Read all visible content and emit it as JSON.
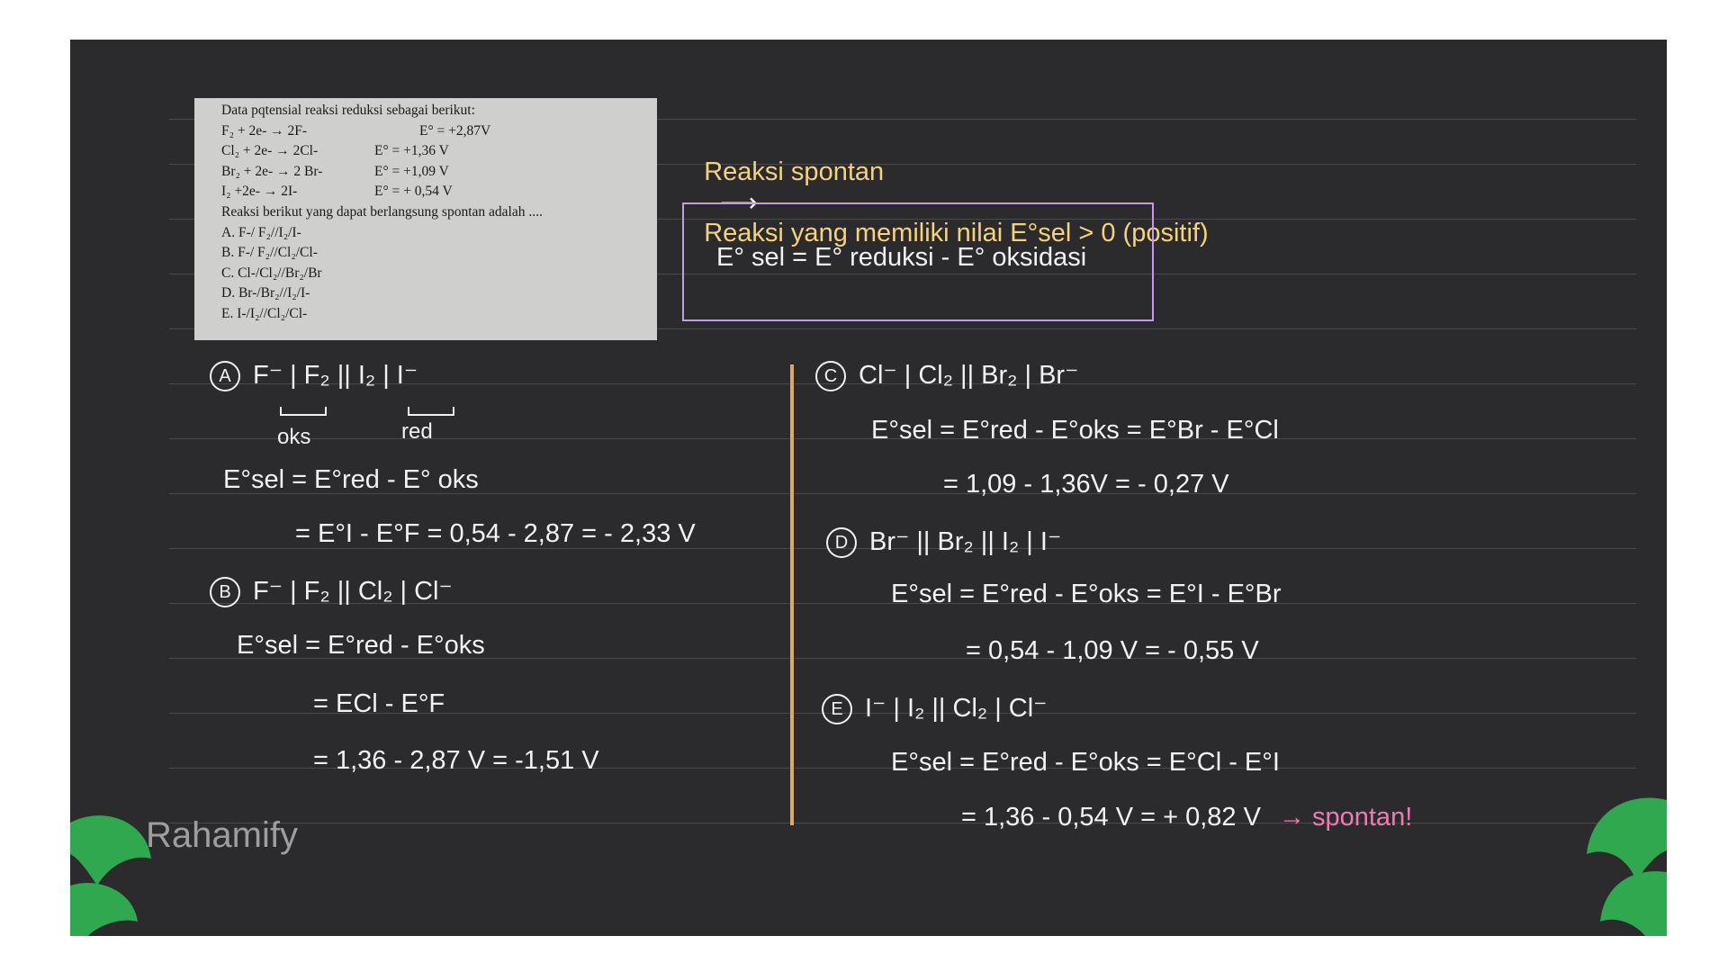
{
  "question": {
    "title": "Data pqtensial reaksi reduksi sebagai berikut:",
    "reactions": [
      {
        "eq": "F₂ + 2e- → 2F-",
        "pot": "E° = +2,87V"
      },
      {
        "eq": "Cl₂ + 2e- → 2Cl-",
        "pot": "E° = +1,36 V"
      },
      {
        "eq": "Br₂ + 2e- → 2 Br-",
        "pot": "E° = +1,09 V"
      },
      {
        "eq": "I₂ +2e- → 2I-",
        "pot": "E° = + 0,54 V"
      }
    ],
    "prompt": "Reaksi berikut yang dapat berlangsung spontan adalah ....",
    "options": [
      "A. F-/ F₂//I₂/I-",
      "B. F-/ F₂//Cl₂/Cl-",
      "C. Cl-/Cl₂//Br₂/Br",
      "D. Br-/Br₂//I₂/I-",
      "E. I-/I₂//Cl₂/Cl-"
    ]
  },
  "definition": {
    "text1": "Reaksi spontan",
    "arrow": "⟶",
    "text2": "Reaksi yang memiliki nilai E°sel > 0 (positif)"
  },
  "formula": "E° sel = E° reduksi - E° oksidasi",
  "solution_a": {
    "marker": "A",
    "cell": "F⁻ | F₂ || I₂ | I⁻",
    "label_oks": "oks",
    "label_red": "red",
    "line1": "E°sel = E°red - E° oks",
    "line2": "= E°I - E°F = 0,54 - 2,87 = - 2,33 V"
  },
  "solution_b": {
    "marker": "B",
    "cell": "F⁻ | F₂ || Cl₂ | Cl⁻",
    "line1": "E°sel = E°red - E°oks",
    "line2": "= ECl - E°F",
    "line3": "= 1,36 - 2,87 V = -1,51 V"
  },
  "solution_c": {
    "marker": "C",
    "cell": "Cl⁻ | Cl₂ || Br₂ | Br⁻",
    "line1": "E°sel = E°red - E°oks = E°Br - E°Cl",
    "line2": "= 1,09 - 1,36V = - 0,27 V"
  },
  "solution_d": {
    "marker": "D",
    "cell": "Br⁻ || Br₂ || I₂ | I⁻",
    "line1": "E°sel = E°red - E°oks = E°I - E°Br",
    "line2": "= 0,54 - 1,09 V = - 0,55 V"
  },
  "solution_e": {
    "marker": "E",
    "cell": "I⁻ | I₂ || Cl₂ | Cl⁻",
    "line1": "E°sel = E°red - E°oks = E°Cl - E°I",
    "line2": "= 1,36 - 0,54 V = + 0,82 V",
    "conclusion": "→ spontan!"
  },
  "brand": {
    "logo_text": "Rahamify",
    "leaf_color": "#2fa84f"
  }
}
